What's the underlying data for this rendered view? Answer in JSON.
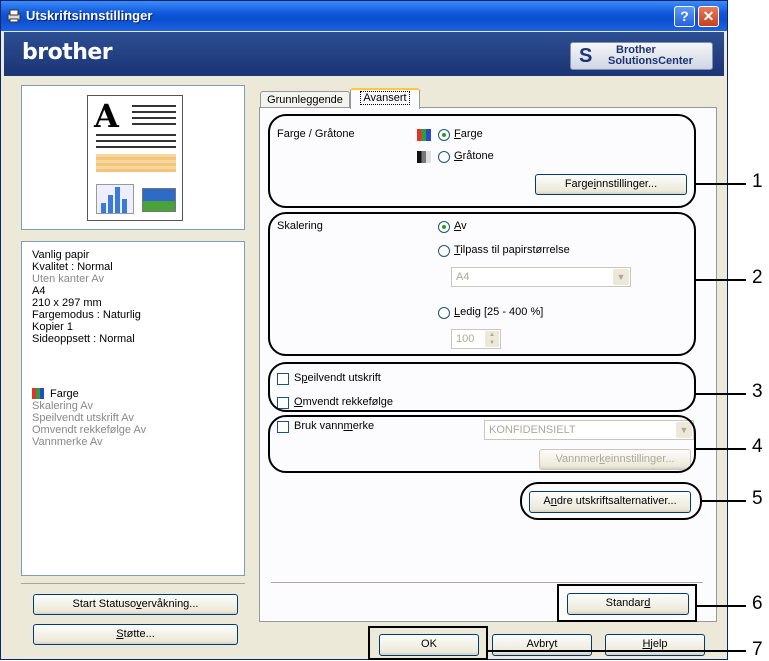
{
  "window": {
    "title": "Utskriftsinnstillinger",
    "help_glyph": "?",
    "close_glyph": "✕",
    "brand": "brother",
    "solutions_line1": "Brother",
    "solutions_line2": "SolutionsCenter"
  },
  "summary": {
    "lines": [
      "Vanlig papir",
      "Kvalitet : Normal",
      "Uten kanter Av",
      "A4",
      "210 x 297 mm",
      "Fargemodus : Naturlig",
      "Kopier  1",
      "Sideoppsett : Normal",
      "Farge",
      "Skalering Av",
      "Speilvendt utskrift Av",
      "Omvendt rekkefølge Av",
      "Vannmerke Av"
    ]
  },
  "left_buttons": {
    "status_pre": "Start Statuso",
    "status_u": "v",
    "status_post": "ervåkning...",
    "support_u": "S",
    "support_post": "tøtte..."
  },
  "tabs": {
    "basic": "Grunnleggende",
    "advanced": "Avansert"
  },
  "color": {
    "label": "Farge / Gråtone",
    "farge_u": "F",
    "farge_rest": "arge",
    "graa_u": "G",
    "graa_rest": "råtone",
    "settings_pre": "Farge",
    "settings_u": "i",
    "settings_post": "nnstillinger..."
  },
  "scaling": {
    "label": "Skalering",
    "off_u": "A",
    "off_rest": "v",
    "fit_u": "T",
    "fit_rest": "ilpass til papirstørrelse",
    "paper_value": "A4",
    "free_u": "L",
    "free_rest": "edig [25 - 400 %]",
    "free_value": "100"
  },
  "mirror": {
    "pre": "S",
    "u": "p",
    "post": "eilvendt utskrift"
  },
  "reverse": {
    "u": "O",
    "post": "mvendt rekkefølge"
  },
  "watermark": {
    "pre": "Bruk vann",
    "u": "m",
    "post": "erke",
    "select_value": "KONFIDENSIELT",
    "settings_pre": "Vannmer",
    "settings_u": "k",
    "settings_post": "einnstillinger..."
  },
  "other_options": {
    "pre": "A",
    "u": "n",
    "post": "dre utskriftsalternativer..."
  },
  "default_button": {
    "pre": "Standar",
    "u": "d"
  },
  "dialog_buttons": {
    "ok": "OK",
    "cancel": "Avbryt",
    "help_u": "H",
    "help_rest": "jelp"
  },
  "callouts": [
    "1",
    "2",
    "3",
    "4",
    "5",
    "6",
    "7"
  ],
  "colors": {
    "title_blue": "#0a4ed1",
    "brand_bar": "#1a3475",
    "radio_dot": "#21a121",
    "tab_highlight": "#ffc83c"
  }
}
